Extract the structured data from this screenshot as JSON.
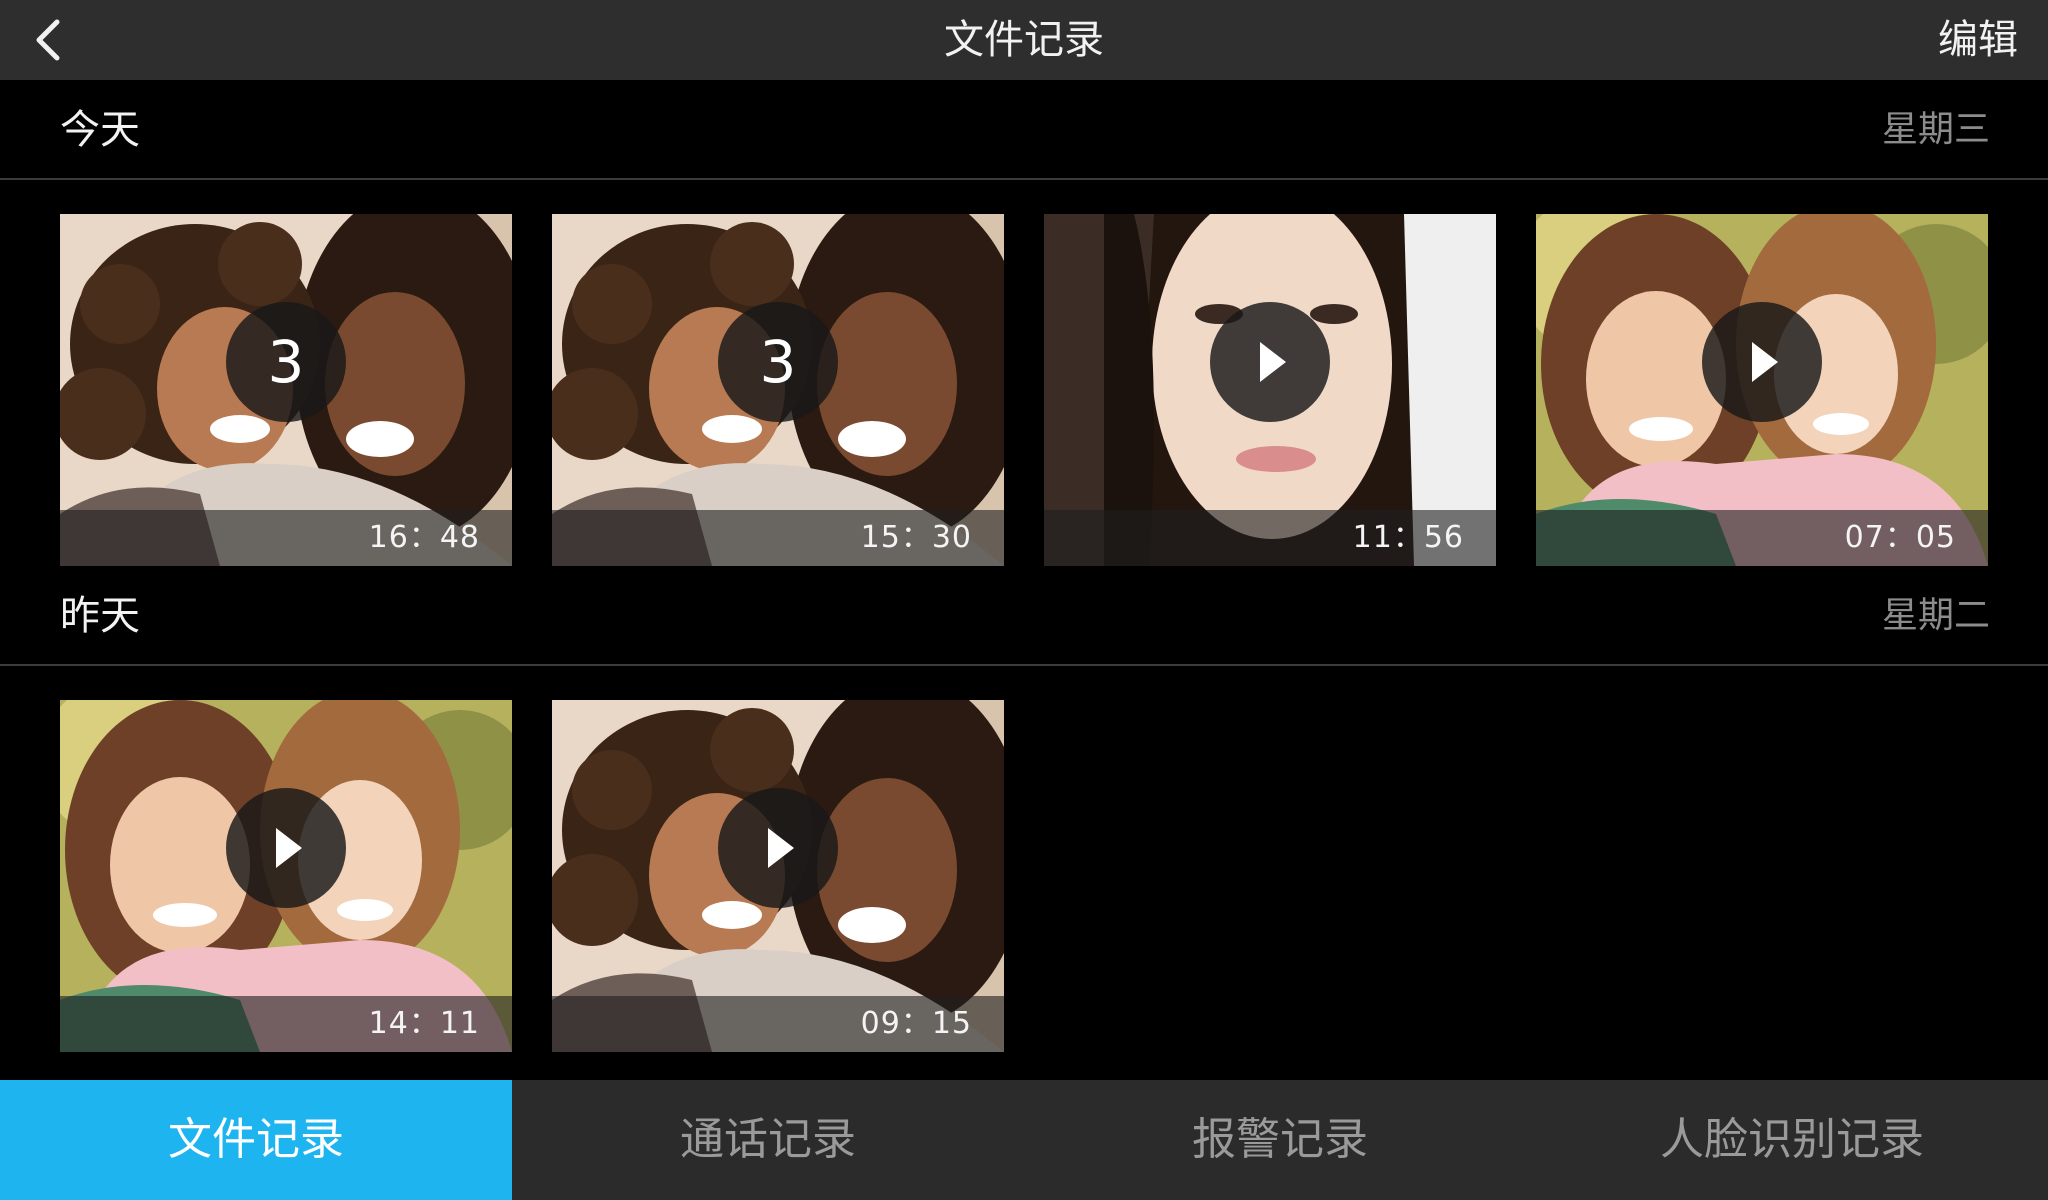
{
  "header": {
    "title": "文件记录",
    "edit_label": "编辑",
    "back_icon": "chevron-left-icon"
  },
  "sections": [
    {
      "label": "今天",
      "weekday": "星期三",
      "items": [
        {
          "time": "16：48",
          "count": "3",
          "badge": "count",
          "photo": "mother-daughter-curly"
        },
        {
          "time": "15：30",
          "count": "3",
          "badge": "count",
          "photo": "mother-daughter-curly"
        },
        {
          "time": "11：56",
          "badge": "play",
          "photo": "woman-portrait"
        },
        {
          "time": "07：05",
          "badge": "play",
          "photo": "mother-daughter-outdoor"
        }
      ]
    },
    {
      "label": "昨天",
      "weekday": "星期二",
      "items": [
        {
          "time": "14：11",
          "badge": "play",
          "photo": "mother-daughter-outdoor"
        },
        {
          "time": "09：15",
          "badge": "play",
          "photo": "mother-daughter-curly"
        }
      ]
    }
  ],
  "tabs": [
    {
      "label": "文件记录",
      "active": true
    },
    {
      "label": "通话记录",
      "active": false
    },
    {
      "label": "报警记录",
      "active": false
    },
    {
      "label": "人脸识别记录",
      "active": false
    }
  ],
  "colors": {
    "header_bg": "#2e2e2e",
    "tabbar_bg": "#2b2b2b",
    "tab_active": "#1eb4f0",
    "weekday_text": "#8c8c8c"
  }
}
